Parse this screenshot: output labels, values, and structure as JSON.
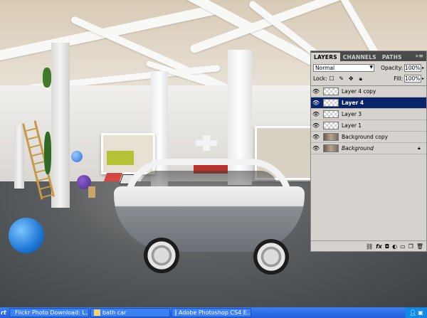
{
  "canvas": {
    "scene": "photo"
  },
  "layers_panel": {
    "tabs": [
      "LAYERS",
      "CHANNELS",
      "PATHS"
    ],
    "active_tab": "LAYERS",
    "blend_mode": "Normal",
    "opacity_label": "Opacity:",
    "opacity_value": "100%",
    "lock_label": "Lock:",
    "fill_label": "Fill:",
    "fill_value": "100%",
    "layers": [
      {
        "name": "Layer 4 copy",
        "visible": true,
        "selected": false,
        "thumb": "transparent"
      },
      {
        "name": "Layer 4",
        "visible": true,
        "selected": true,
        "thumb": "transparent"
      },
      {
        "name": "Layer 3",
        "visible": true,
        "selected": false,
        "thumb": "transparent"
      },
      {
        "name": "Layer 1",
        "visible": true,
        "selected": false,
        "thumb": "transparent"
      },
      {
        "name": "Background copy",
        "visible": true,
        "selected": false,
        "thumb": "photo"
      },
      {
        "name": "Background",
        "visible": true,
        "selected": false,
        "thumb": "photo",
        "locked": true
      }
    ],
    "selected_color": "#0a246a"
  },
  "taskbar": {
    "start_label": "rt",
    "buttons": [
      {
        "label": "Flickr Photo Download: L...",
        "icon": "browser-icon"
      },
      {
        "label": "bath car",
        "icon": "folder-icon"
      },
      {
        "label": "Adobe Photoshop CS4 E...",
        "icon": "photoshop-icon"
      }
    ],
    "color": "#245edb"
  }
}
